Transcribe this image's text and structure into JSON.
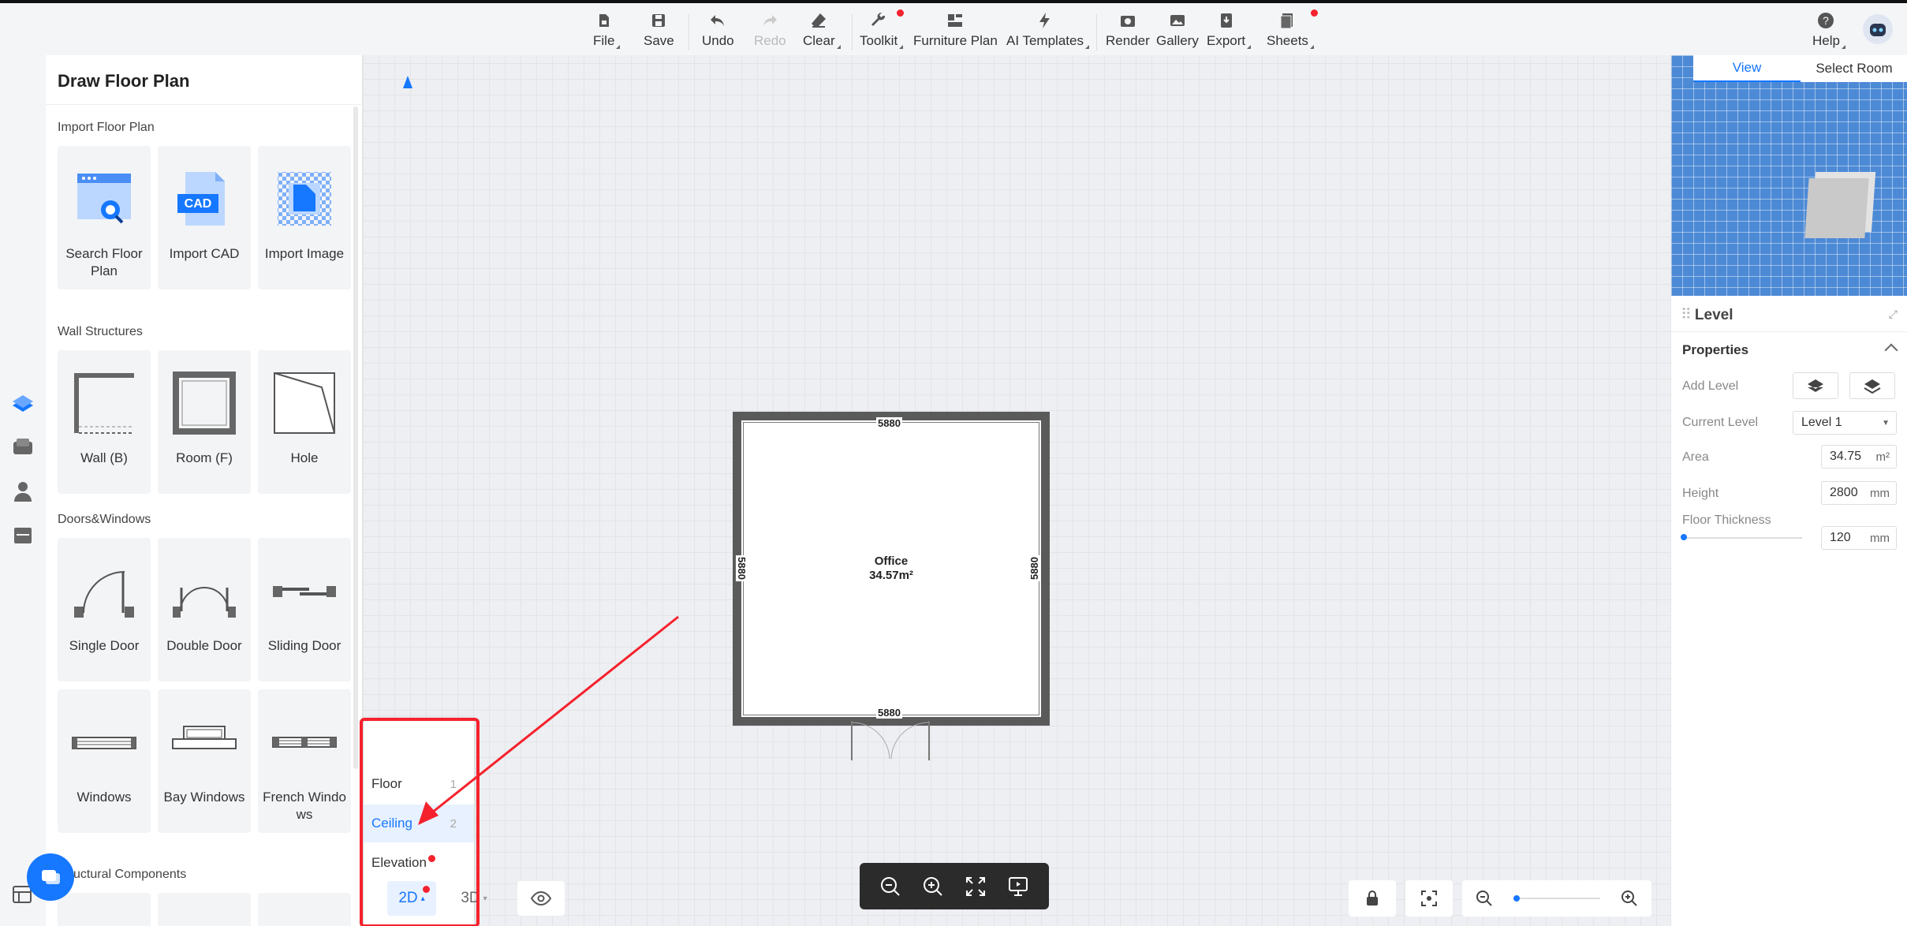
{
  "toolbar": {
    "file": "File",
    "save": "Save",
    "undo": "Undo",
    "redo": "Redo",
    "clear": "Clear",
    "toolkit": "Toolkit",
    "furniture_plan": "Furniture Plan",
    "ai_templates": "AI Templates",
    "render": "Render",
    "gallery": "Gallery",
    "export": "Export",
    "sheets": "Sheets",
    "help": "Help"
  },
  "panel": {
    "title": "Draw Floor Plan",
    "sections": {
      "import": "Import Floor Plan",
      "walls": "Wall Structures",
      "doors": "Doors&Windows",
      "structural": "uctural Components"
    },
    "import_items": [
      "Search Floor Plan",
      "Import CAD",
      "Import Image"
    ],
    "cad_badge": "CAD",
    "wall_items": [
      "Wall (B)",
      "Room (F)",
      "Hole"
    ],
    "door_items": [
      "Single Door",
      "Double Door",
      "Sliding Door"
    ],
    "window_items": [
      "Windows",
      "Bay Windows",
      "French Windows"
    ]
  },
  "viewer": {
    "tab_view": "View",
    "tab_select_room": "Select Room"
  },
  "properties": {
    "panel_title": "Level",
    "section": "Properties",
    "add_level": "Add Level",
    "current_level_label": "Current Level",
    "current_level_value": "Level 1",
    "area_label": "Area",
    "area_value": "34.75",
    "area_unit": "m²",
    "height_label": "Height",
    "height_value": "2800",
    "height_unit": "mm",
    "floor_thickness_label": "Floor Thickness",
    "floor_thickness_value": "120",
    "floor_thickness_unit": "mm"
  },
  "room": {
    "name": "Office",
    "area": "34.57m²",
    "dim_top": "5880",
    "dim_bottom": "5880",
    "dim_left": "5880",
    "dim_right": "5880"
  },
  "popup": {
    "items": [
      {
        "label": "Floor",
        "num": "1"
      },
      {
        "label": "Ceiling",
        "num": "2"
      },
      {
        "label": "Elevation",
        "num": ""
      }
    ]
  },
  "mode": {
    "two_d": "2D",
    "three_d": "3D"
  },
  "colors": {
    "accent": "#1677ff",
    "annotation_red": "#f5222d"
  }
}
